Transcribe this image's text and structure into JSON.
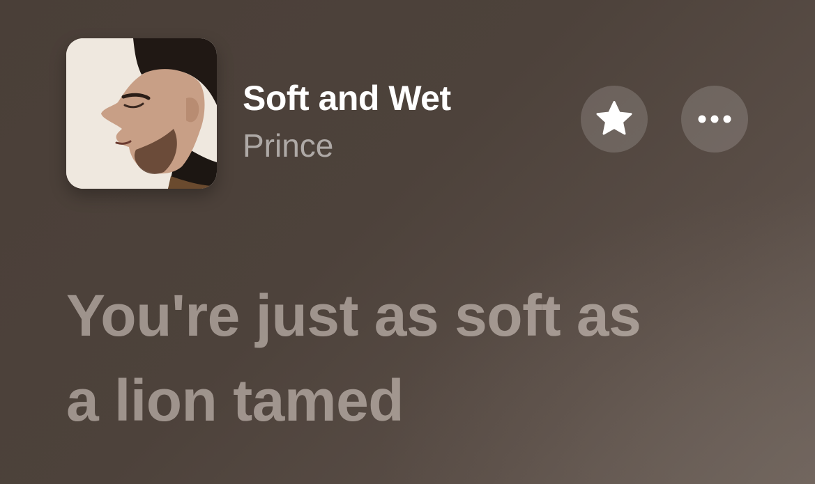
{
  "now_playing": {
    "artwork_icon": "album-art-portrait",
    "title": "Soft and Wet",
    "artist": "Prince"
  },
  "actions": {
    "favorite_icon": "star-icon",
    "more_icon": "ellipsis-icon"
  },
  "lyrics": {
    "lines": [
      "You're just as soft as",
      "a lion tamed"
    ]
  },
  "colors": {
    "background": "#4d423b",
    "title": "#ffffff",
    "artist": "#a59c96",
    "lyrics": "#a0948c",
    "button_bg": "#6b625c"
  }
}
